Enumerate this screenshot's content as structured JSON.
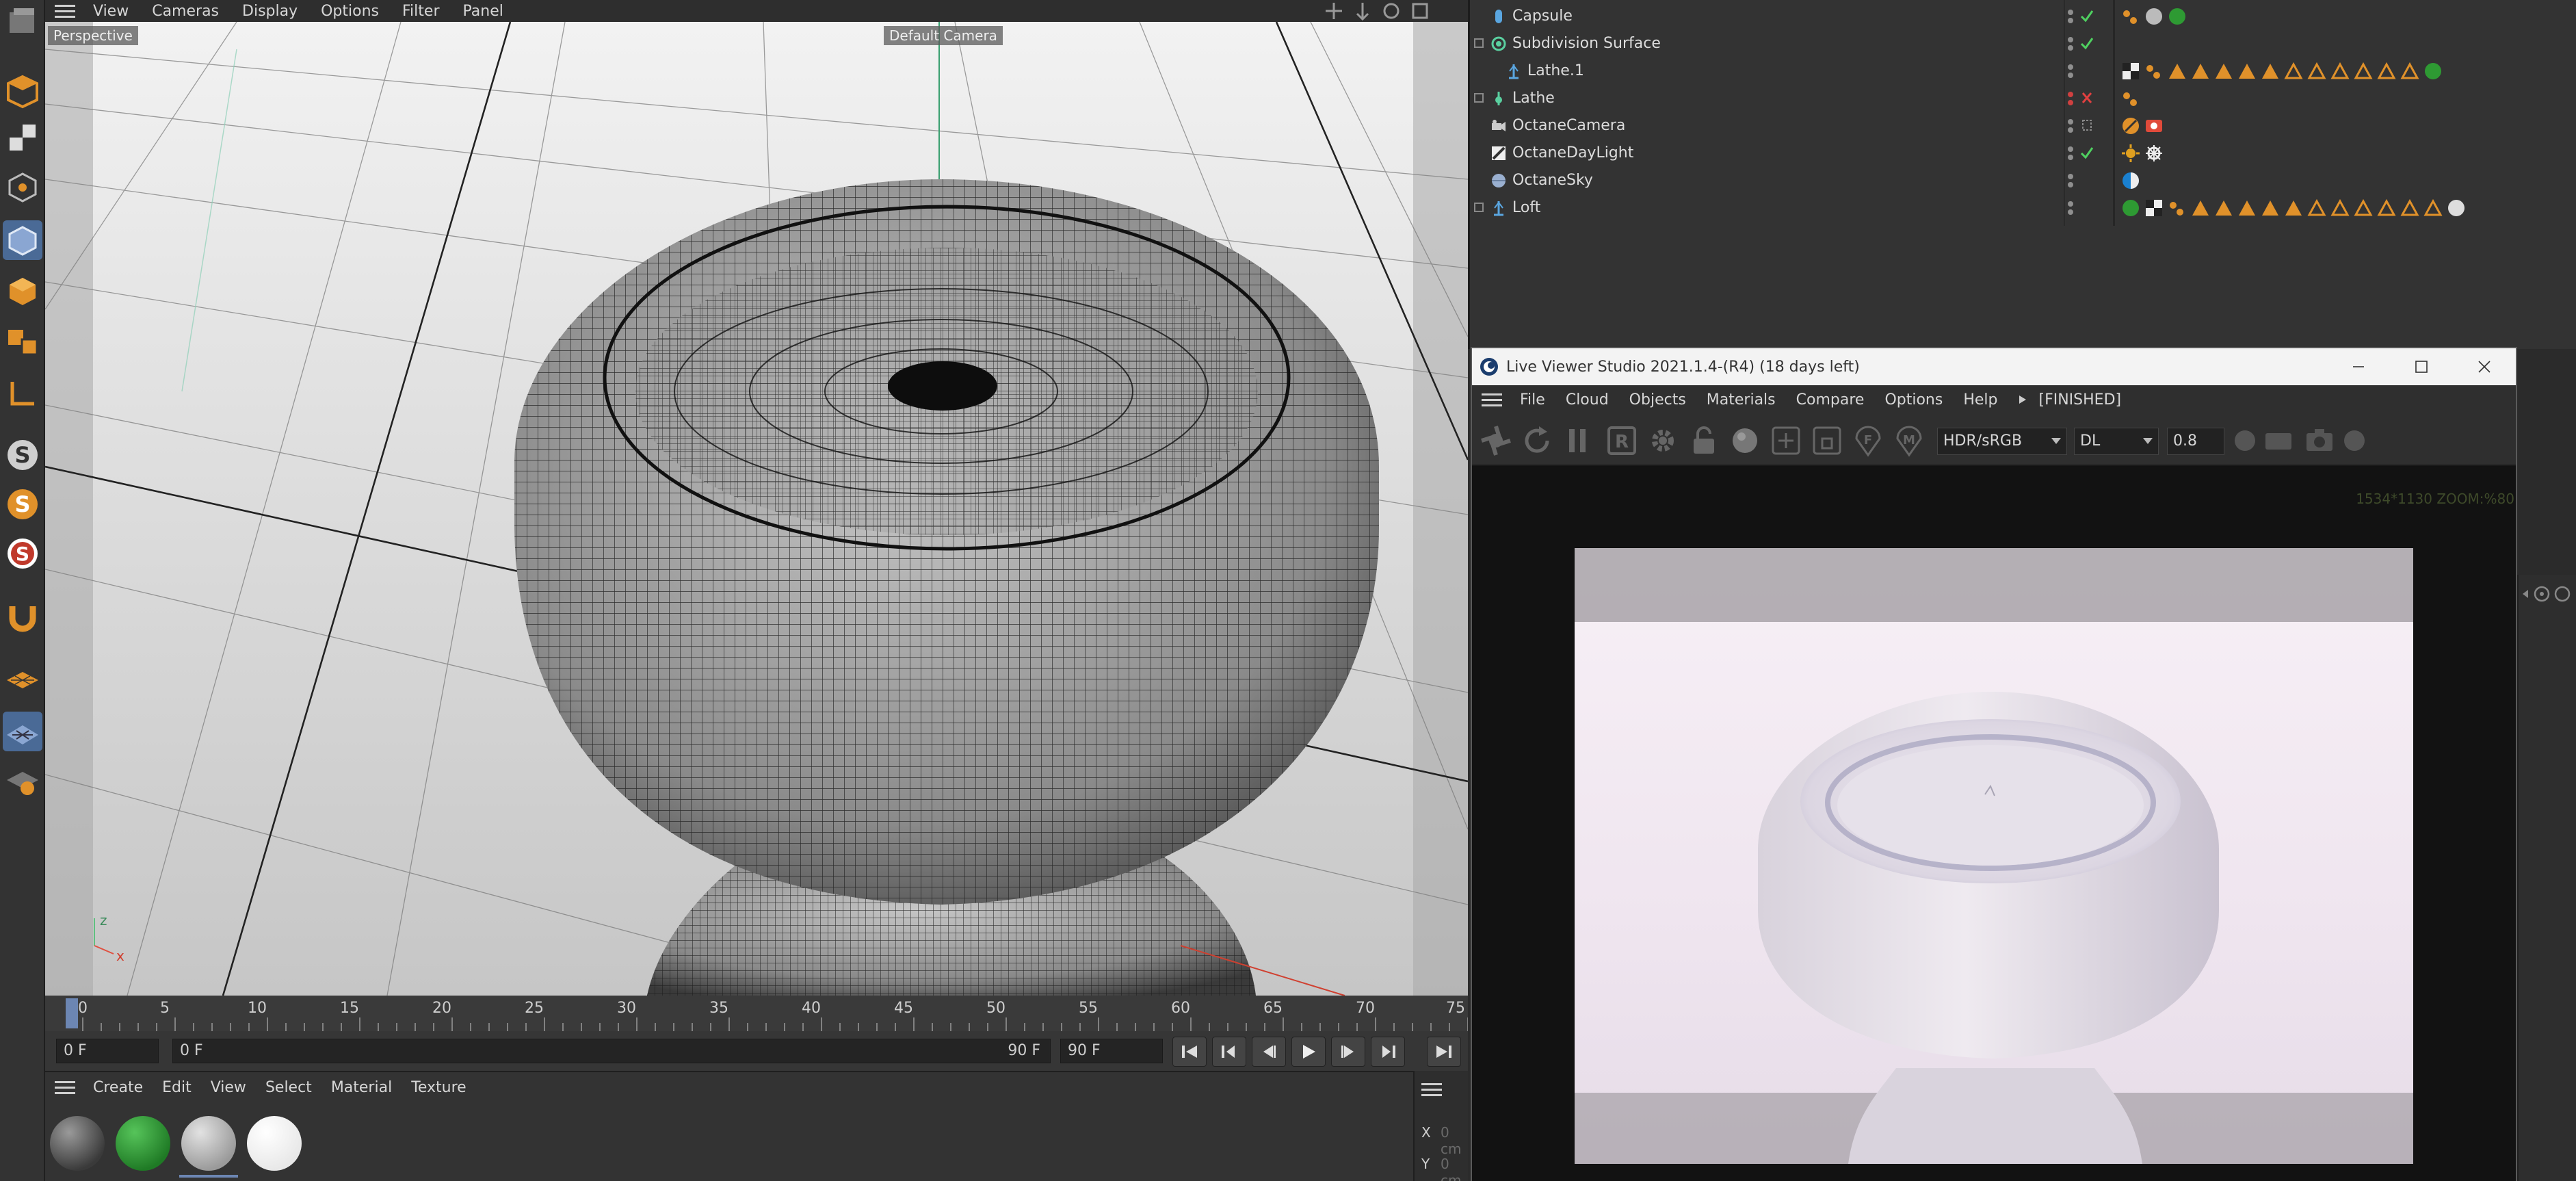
{
  "viewport": {
    "menu": [
      "View",
      "Cameras",
      "Display",
      "Options",
      "Filter",
      "Panel"
    ],
    "projection_label": "Perspective",
    "camera_label": "Default Camera"
  },
  "timeline": {
    "ticks": [
      "0",
      "5",
      "10",
      "15",
      "20",
      "25",
      "30",
      "35",
      "40",
      "45",
      "50",
      "55",
      "60",
      "65",
      "70",
      "75"
    ],
    "current_frame": "0 F",
    "range_start": "0 F",
    "range_end": "90 F",
    "max_frame": "90 F"
  },
  "material_manager": {
    "menu": [
      "Create",
      "Edit",
      "View",
      "Select",
      "Material",
      "Texture"
    ],
    "swatch_colors": [
      "#3a3a3a",
      "#1f7a25",
      "#9a9a9a",
      "#e8e8e8"
    ]
  },
  "attribute_manager": {
    "coord_labels": [
      "X",
      "Y"
    ],
    "coord_unit": "0 cm"
  },
  "object_manager": {
    "objects": [
      {
        "name": "Capsule",
        "indent": 1
      },
      {
        "name": "Subdivision Surface",
        "indent": 1
      },
      {
        "name": "Lathe.1",
        "indent": 2
      },
      {
        "name": "Lathe",
        "indent": 1
      },
      {
        "name": "OctaneCamera",
        "indent": 1
      },
      {
        "name": "OctaneDayLight",
        "indent": 1
      },
      {
        "name": "OctaneSky",
        "indent": 1
      },
      {
        "name": "Loft",
        "indent": 1
      }
    ]
  },
  "live_viewer": {
    "title": "Live Viewer Studio 2021.1.4-(R4) (18 days left)",
    "menu": [
      "File",
      "Cloud",
      "Objects",
      "Materials",
      "Compare",
      "Options",
      "Help"
    ],
    "status": "[FINISHED]",
    "tonemap_select": "HDR/sRGB",
    "kernel_select": "DL",
    "value_field": "0.8",
    "resolution_text": "1534*1130 ZOOM:%80"
  }
}
